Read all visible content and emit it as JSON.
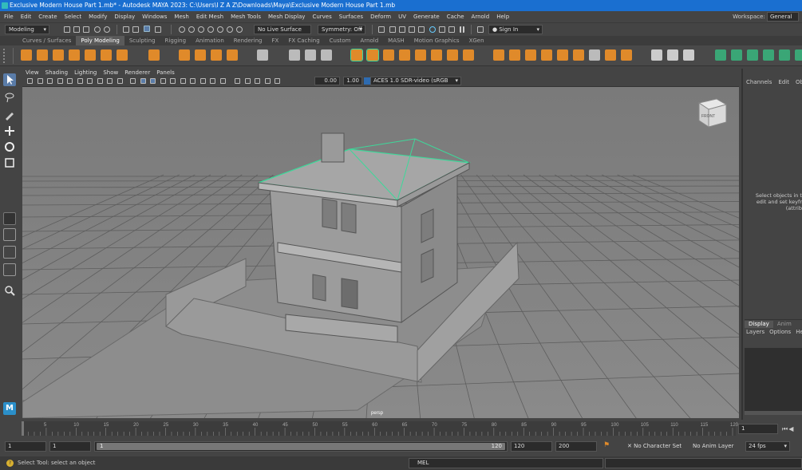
{
  "window": {
    "title": "Exclusive Modern House Part 1.mb* - Autodesk MAYA 2023: C:\\Users\\I Z A Z\\Downloads\\Maya\\Exclusive Modern House Part 1.mb"
  },
  "menubar": {
    "items": [
      "File",
      "Edit",
      "Create",
      "Select",
      "Modify",
      "Display",
      "Windows",
      "Mesh",
      "Edit Mesh",
      "Mesh Tools",
      "Mesh Display",
      "Curves",
      "Surfaces",
      "Deform",
      "UV",
      "Generate",
      "Cache",
      "Arnold",
      "Help"
    ],
    "workspace_label": "Workspace:",
    "workspace_value": "General"
  },
  "statusline": {
    "mode": "Modeling",
    "live_surface": "No Live Surface",
    "symmetry": "Symmetry: Off",
    "sign_in": "Sign In"
  },
  "shelf": {
    "tabs": [
      "Curves / Surfaces",
      "Poly Modeling",
      "Sculpting",
      "Rigging",
      "Animation",
      "Rendering",
      "FX",
      "FX Caching",
      "Custom",
      "Arnold",
      "MASH",
      "Motion Graphics",
      "XGen"
    ],
    "active_tab": "Poly Modeling"
  },
  "panel": {
    "menus": [
      "View",
      "Shading",
      "Lighting",
      "Show",
      "Renderer",
      "Panels"
    ],
    "exposure": "0.00",
    "gamma": "1.00",
    "color_space": "ACES 1.0 SDR-video (sRGB"
  },
  "viewport": {
    "camera_label": "persp",
    "view_cube_label": "FRONT"
  },
  "channelbox": {
    "tabs": [
      "Channels",
      "Edit",
      "Obje"
    ],
    "hint_line1": "Select objects in t",
    "hint_line2": "edit and set keyfr",
    "hint_line3": "(attrib"
  },
  "layers": {
    "tabs": [
      "Display",
      "Anim"
    ],
    "menus": [
      "Layers",
      "Options",
      "He"
    ]
  },
  "timeline": {
    "ticks": [
      "5",
      "10",
      "15",
      "20",
      "25",
      "30",
      "35",
      "40",
      "45",
      "50",
      "55",
      "60",
      "65",
      "70",
      "75",
      "80",
      "85",
      "90",
      "95",
      "100",
      "105",
      "110",
      "115",
      "120"
    ],
    "current_frame": "1"
  },
  "range": {
    "start": "1",
    "playback_start": "1",
    "slider_start": "1",
    "slider_end": "120",
    "playback_end": "120",
    "end": "200",
    "character_set": "No Character Set",
    "anim_layer": "No Anim Layer",
    "fps": "24 fps"
  },
  "cmdline": {
    "help_text": "Select Tool: select an object",
    "lang": "MEL"
  },
  "colors": {
    "accent": "#1a6fd0",
    "shelf_orange": "#e08a2a",
    "selection_green": "#3ed89a"
  }
}
